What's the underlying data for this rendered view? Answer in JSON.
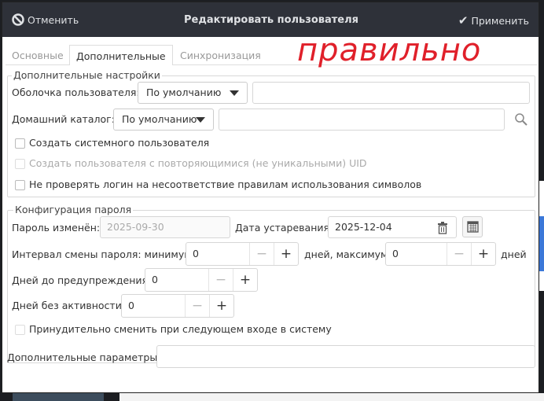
{
  "header": {
    "cancel": "Отменить",
    "title": "Редактировать пользователя",
    "apply": "Применить"
  },
  "tabs": [
    "Основные",
    "Дополнительные",
    "Синхронизация"
  ],
  "annotation": "правильно",
  "advanced": {
    "legend": "Дополнительные настройки",
    "shell_label": "Оболочка пользователя:",
    "shell_value": "По умолчанию",
    "shell_input": "",
    "home_label": "Домашний каталог:",
    "home_value": "По умолчанию",
    "home_input": "",
    "cb_system": "Создать системного пользователя",
    "cb_nonunique": "Создать пользователя с повторяющимися (не уникальными) UID",
    "cb_nocheck": "Не проверять логин на несоответствие правилам использования символов"
  },
  "password": {
    "legend": "Конфигурация пароля",
    "changed_label": "Пароль изменён:",
    "changed_value": "2025-09-30",
    "expire_label": "Дата устаревания:",
    "expire_value": "2025-12-04",
    "interval_label": "Интервал смены пароля: минимум",
    "min_value": "0",
    "max_label": "дней, максимум",
    "max_value": "0",
    "days": "дней",
    "warn_label": "Дней до предупреждения:",
    "warn_value": "0",
    "inactive_label": "Дней без активности:",
    "inactive_value": "0",
    "force_label": "Принудительно сменить при следующем входе в систему"
  },
  "extra": {
    "label": "Дополнительные параметры:",
    "value": ""
  },
  "spin": {
    "minus": "−",
    "plus": "+"
  }
}
